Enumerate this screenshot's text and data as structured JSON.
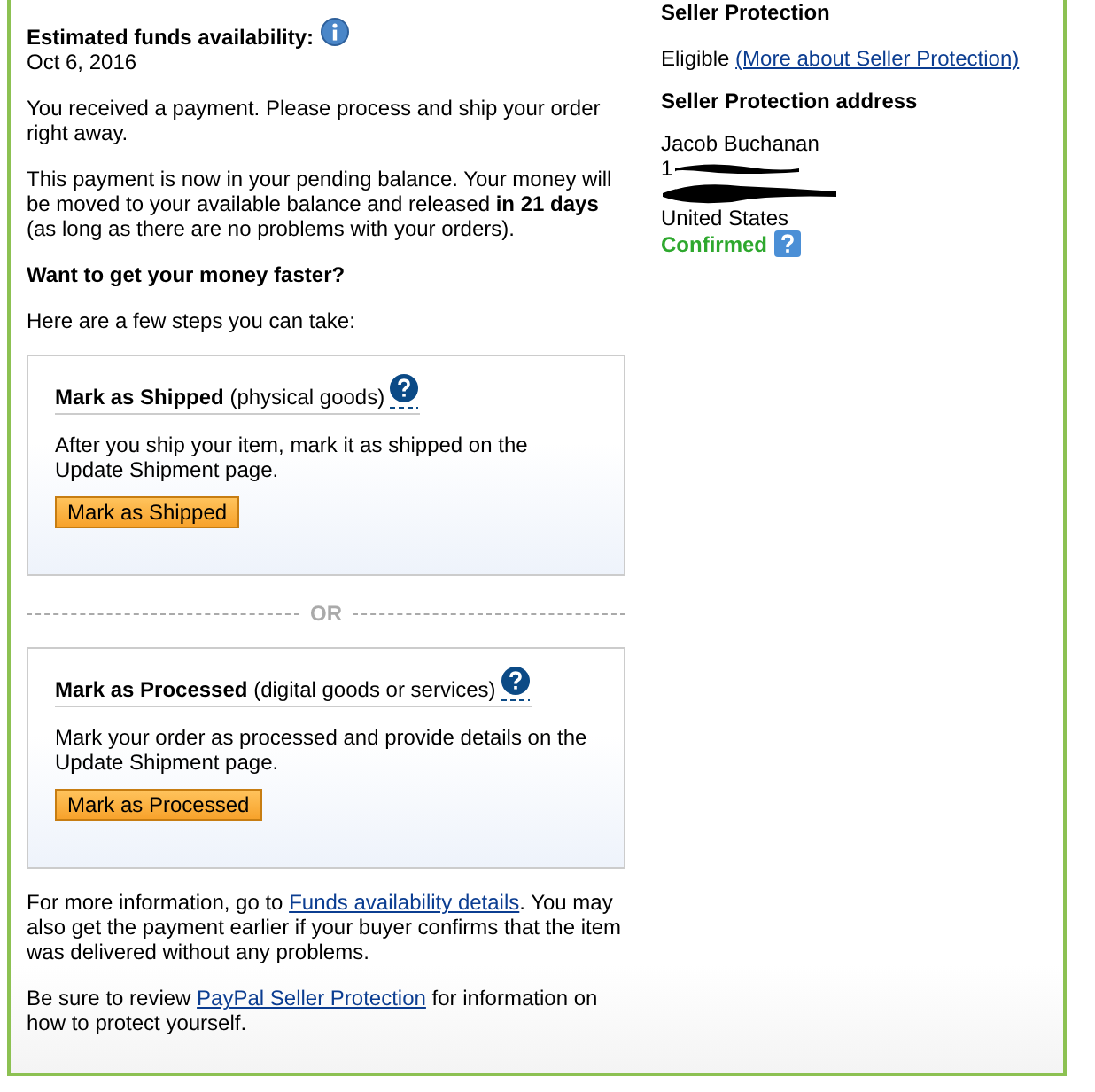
{
  "funds": {
    "label": "Estimated funds availability:",
    "date": "Oct 6, 2016"
  },
  "paragraphs": [
    "You received a payment. Please process and ship your order right away.",
    "This payment is now in your pending balance. Your money will be moved to your available balance and released **in 21 days** (as long as there are no problems with your orders)."
  ],
  "faster_heading": "Want to get your money faster?",
  "steps_intro": "Here are a few steps you can take:",
  "options": [
    {
      "title": "Mark as Shipped",
      "note": "(physical goods)",
      "text": "After you ship your item, mark it as shipped on the Update Shipment page.",
      "button": "Mark as Shipped"
    },
    {
      "title": "Mark as Processed",
      "note": "(digital goods or services)",
      "text": "Mark your order as processed and provide details on the Update Shipment page.",
      "button": "Mark as Processed"
    }
  ],
  "divider": "OR",
  "more_info": {
    "before": "For more information, go to ",
    "link": "Funds availability details",
    "after": ". You may also get the payment earlier if your buyer confirms that the item was delivered without any problems."
  },
  "review": {
    "before": "Be sure to review ",
    "link": "PayPal Seller Protection",
    "after": " for information on how to protect yourself."
  },
  "seller_protection": {
    "heading": "Seller Protection",
    "status": "Eligible",
    "link": "(More about Seller Protection)",
    "address_heading": "Seller Protection address",
    "name": "Jacob Buchanan",
    "address_line_1": "1",
    "country": "United States",
    "confirmation": "Confirmed"
  }
}
